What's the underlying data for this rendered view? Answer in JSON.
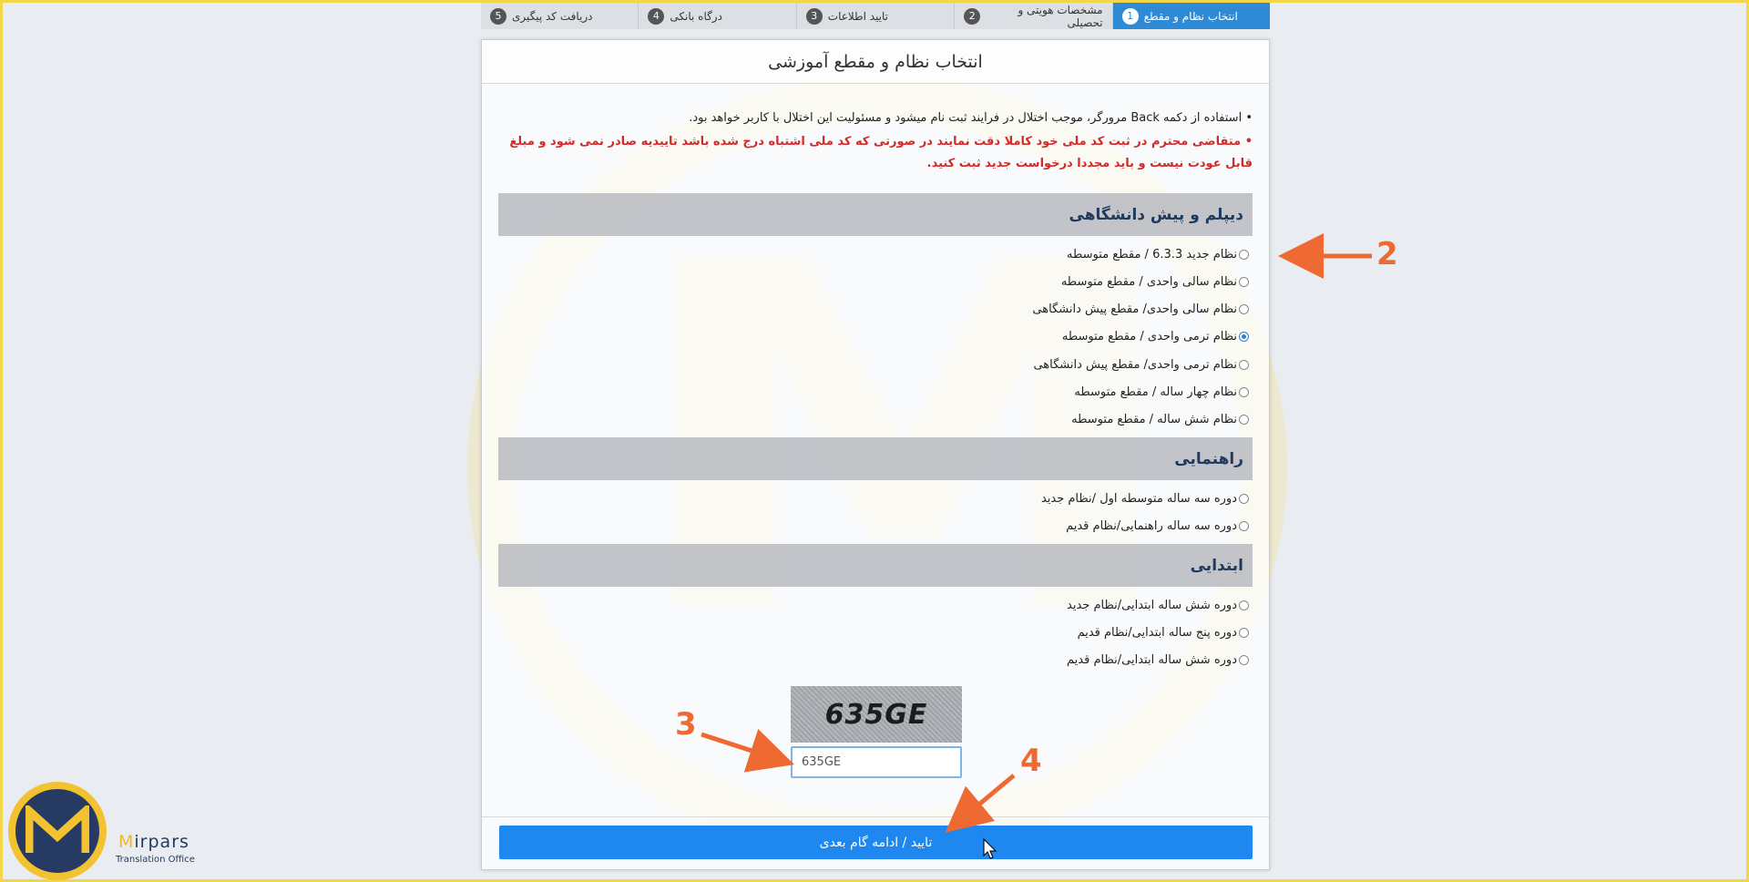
{
  "stepper": {
    "steps": [
      {
        "num": "1",
        "label": "انتخاب نظام و مقطع",
        "active": true
      },
      {
        "num": "2",
        "label": "مشخصات هویتی و تحصیلی"
      },
      {
        "num": "3",
        "label": "تایید اطلاعات"
      },
      {
        "num": "4",
        "label": "درگاه بانکی"
      },
      {
        "num": "5",
        "label": "دریافت کد پیگیری"
      }
    ]
  },
  "panel": {
    "title": "انتخاب نظام و مقطع آموزشی",
    "note1": "• استفاده از دکمه Back مرورگر، موجب اختلال در فرایند ثبت نام میشود و مسئولیت این اختلال با کاربر خواهد بود.",
    "note2": "• متقاضی محترم در ثبت کد ملی خود کاملا دقت نمایند در صورتی که کد ملی اشتباه درج شده باشد تاییدیه صادر نمی شود و مبلغ قابل عودت نیست و باید مجددا درخواست جدید ثبت کنید."
  },
  "sections": {
    "diploma": {
      "title": "دیپلم و پیش دانشگاهی",
      "options": [
        "نظام جدید 6.3.3 / مقطع متوسطه",
        "نظام سالی واحدی / مقطع متوسطه",
        "نظام سالی واحدی/ مقطع پیش دانشگاهی",
        "نظام ترمی واحدی / مقطع متوسطه",
        "نظام ترمی واحدی/ مقطع پیش دانشگاهی",
        "نظام چهار ساله / مقطع متوسطه",
        "نظام شش ساله / مقطع متوسطه"
      ],
      "selected_index": 3
    },
    "guidance": {
      "title": "راهنمایی",
      "options": [
        "دوره سه ساله متوسطه اول /نظام جدید",
        "دوره سه ساله راهنمایی/نظام قدیم"
      ]
    },
    "primary": {
      "title": "ابتدایی",
      "options": [
        "دوره شش ساله ابتدایی/نظام جدید",
        "دوره پنج ساله ابتدایی/نظام قدیم",
        "دوره شش ساله ابتدایی/نظام قدیم"
      ]
    }
  },
  "captcha": {
    "image_text": "635GE",
    "input_value": "635GE"
  },
  "submit_label": "تایید / ادامه گام بعدی",
  "annotations": {
    "n2": "2",
    "n3": "3",
    "n4": "4"
  },
  "logo": {
    "brand_first": "M",
    "brand_rest": "irpars",
    "sub": "Translation Office"
  },
  "colors": {
    "accent_blue": "#1e87f0",
    "warning_red": "#d42a2a",
    "annotation_orange": "#ee6a32",
    "logo_gold": "#f2c230"
  }
}
